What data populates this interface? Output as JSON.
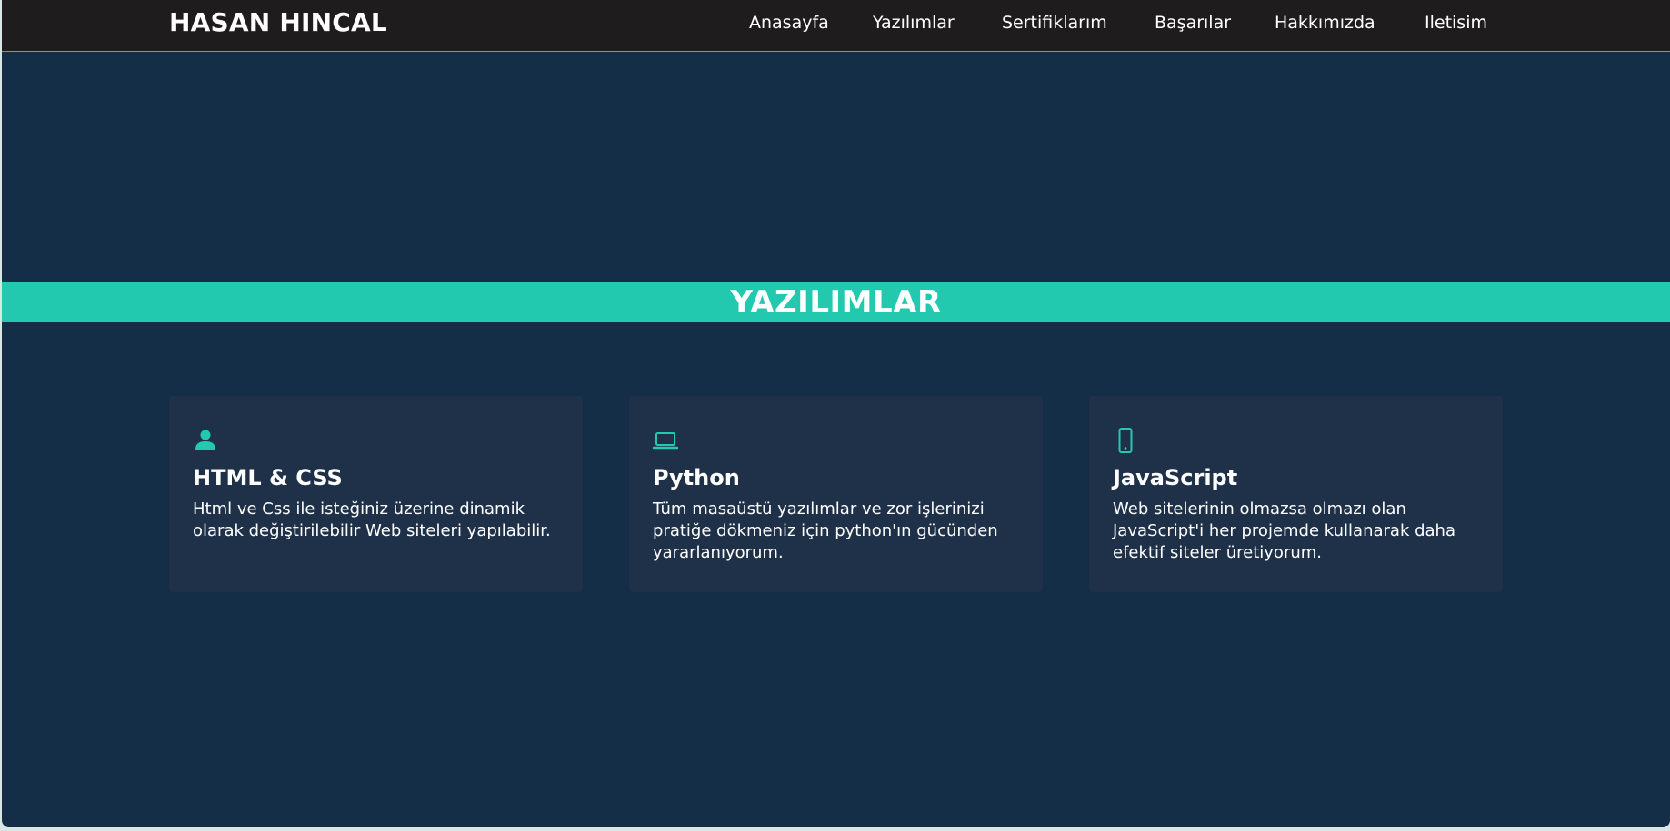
{
  "header": {
    "brand": "HASAN HINCAL",
    "nav": [
      {
        "label": "Anasayfa"
      },
      {
        "label": "Yazılımlar"
      },
      {
        "label": "Sertifiklarım"
      },
      {
        "label": "Başarılar"
      },
      {
        "label": "Hakkımızda"
      },
      {
        "label": "Iletisim"
      }
    ]
  },
  "section": {
    "title": "YAZILIMLAR"
  },
  "cards": [
    {
      "icon": "user-icon",
      "title": "HTML & CSS",
      "text": "Html ve Css ile isteğiniz üzerine dinamik olarak değiştirilebilir Web siteleri yapılabilir."
    },
    {
      "icon": "laptop-icon",
      "title": "Python",
      "text": "Tüm masaüstü yazılımlar ve zor işlerinizi pratiğe dökmeniz için python'ın gücünden yararlanıyorum."
    },
    {
      "icon": "mobile-icon",
      "title": "JavaScript",
      "text": "Web sitelerinin olmazsa olmazı olan JavaScript'i her projemde kullanarak daha efektif siteler üretiyorum."
    }
  ],
  "colors": {
    "navbar_bg": "#1f1c1d",
    "page_bg": "#132e46",
    "accent": "#22c9ae",
    "card_bg": "#1e3148",
    "text": "#ffffff"
  }
}
